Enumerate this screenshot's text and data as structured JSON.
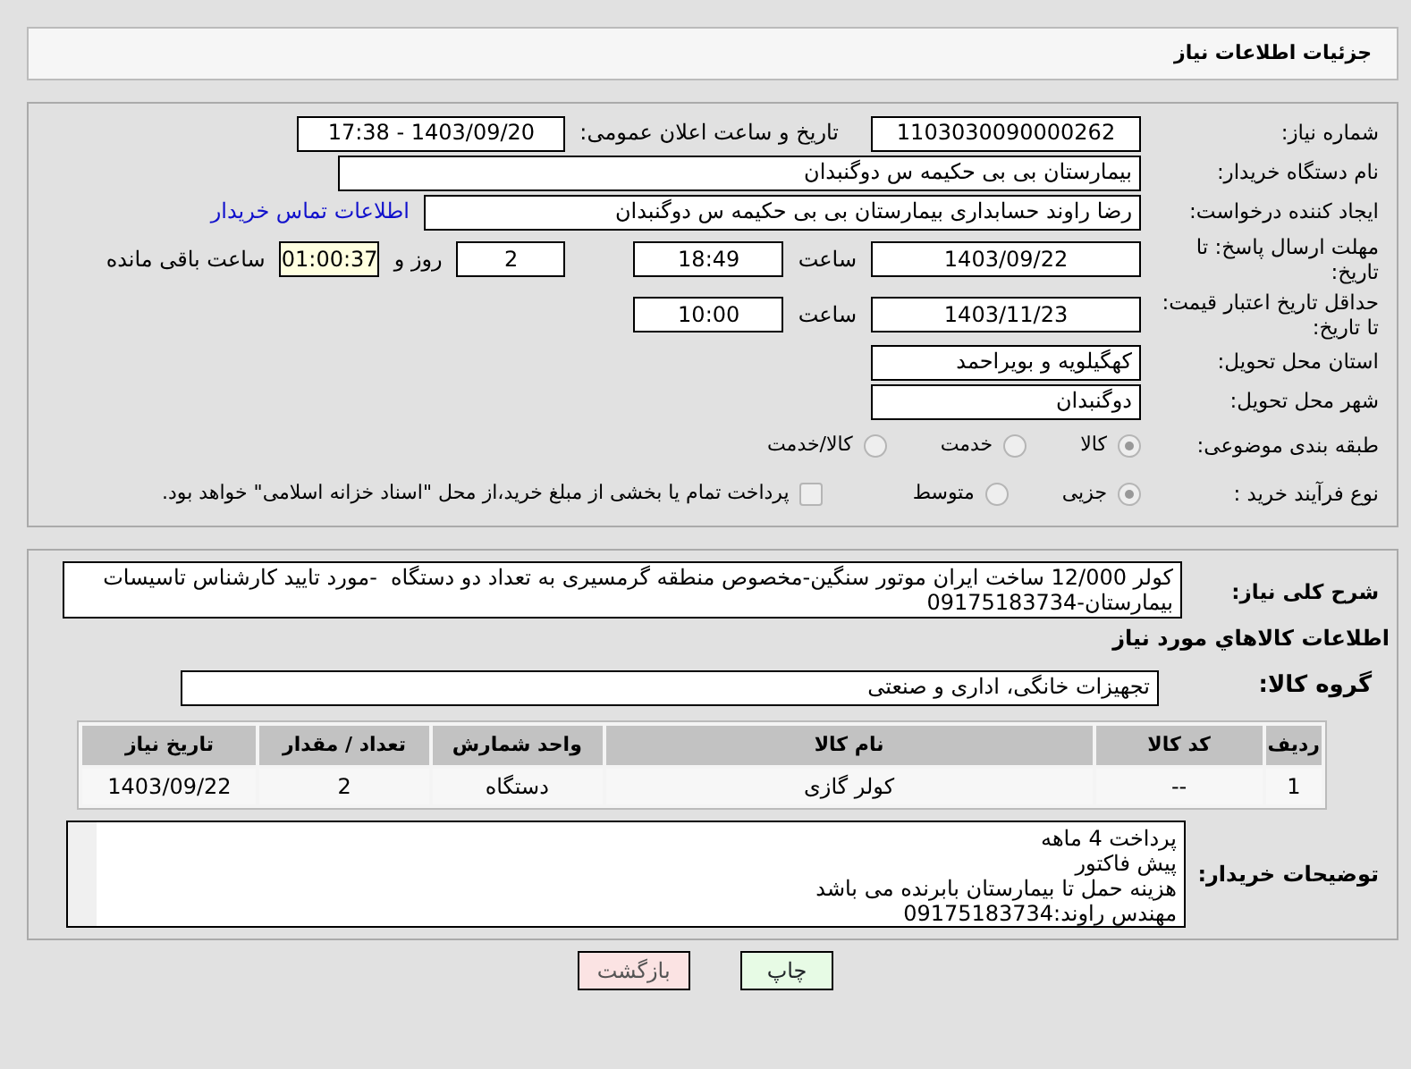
{
  "header": {
    "title": "جزئیات اطلاعات نیاز"
  },
  "need_number": {
    "label": "شماره نیاز:",
    "value": "1103030090000262"
  },
  "announce": {
    "label": "تاریخ و ساعت اعلان عمومی:",
    "value": "1403/09/20 - 17:38"
  },
  "buyer_org": {
    "label": "نام دستگاه خریدار:",
    "value": "بیمارستان بی بی حکیمه س  دوگنبدان"
  },
  "requester": {
    "label": "ایجاد کننده درخواست:",
    "value": "رضا راوند حسابداری بیمارستان بی بی حکیمه س  دوگنبدان",
    "link": "اطلاعات تماس خریدار"
  },
  "reply_deadline": {
    "label": "مهلت ارسال پاسخ: تا تاریخ:",
    "date": "1403/09/22",
    "time_label": "ساعت",
    "time": "18:49",
    "days": "2",
    "days_label": "روز و",
    "remaining": "01:00:37",
    "remaining_label": "ساعت باقی مانده"
  },
  "price_validity": {
    "label": "حداقل تاریخ اعتبار قیمت: تا تاریخ:",
    "date": "1403/11/23",
    "time_label": "ساعت",
    "time": "10:00"
  },
  "province": {
    "label": "استان محل تحویل:",
    "value": "کهگیلویه و بویراحمد"
  },
  "city": {
    "label": "شهر محل تحویل:",
    "value": "دوگنبدان"
  },
  "category": {
    "label": "طبقه بندی موضوعی:",
    "options": [
      {
        "label": "کالا",
        "selected": true
      },
      {
        "label": "خدمت",
        "selected": false
      },
      {
        "label": "کالا/خدمت",
        "selected": false
      }
    ]
  },
  "process": {
    "label": "نوع فرآیند خرید :",
    "options": [
      {
        "label": "جزیی",
        "selected": true
      },
      {
        "label": "متوسط",
        "selected": false
      }
    ],
    "checkbox": {
      "label": "پرداخت تمام یا بخشی از مبلغ خرید،از محل \"اسناد خزانه اسلامی\" خواهد بود.",
      "checked": false
    }
  },
  "summary": {
    "label": "شرح کلی نیاز:",
    "value": "کولر 12/000 ساخت ایران موتور سنگین-مخصوص منطقه گرمسیری به تعداد دو دستگاه  -مورد تایید کارشناس تاسیسات بیمارستان-09175183734"
  },
  "items_title": "اطلاعات کالاهاي مورد نياز",
  "goods_group": {
    "label": "گروه کالا:",
    "value": "تجهیزات خانگی، اداری و صنعتی"
  },
  "table": {
    "columns": [
      "ردیف",
      "کد کالا",
      "نام کالا",
      "واحد شمارش",
      "تعداد / مقدار",
      "تاریخ نیاز"
    ],
    "rows": [
      [
        "1",
        "--",
        "کولر گازی",
        "دستگاه",
        "2",
        "1403/09/22"
      ]
    ]
  },
  "buyer_notes": {
    "label": "توضیحات خریدار:",
    "lines": [
      "پرداخت 4 ماهه",
      "پیش فاکتور",
      "هزینه حمل تا بیمارستان بابرنده می باشد",
      "مهندس راوند:09175183734"
    ]
  },
  "buttons": [
    {
      "label": "چاپ",
      "kind": "print"
    },
    {
      "label": "بازگشت",
      "kind": "back"
    }
  ]
}
